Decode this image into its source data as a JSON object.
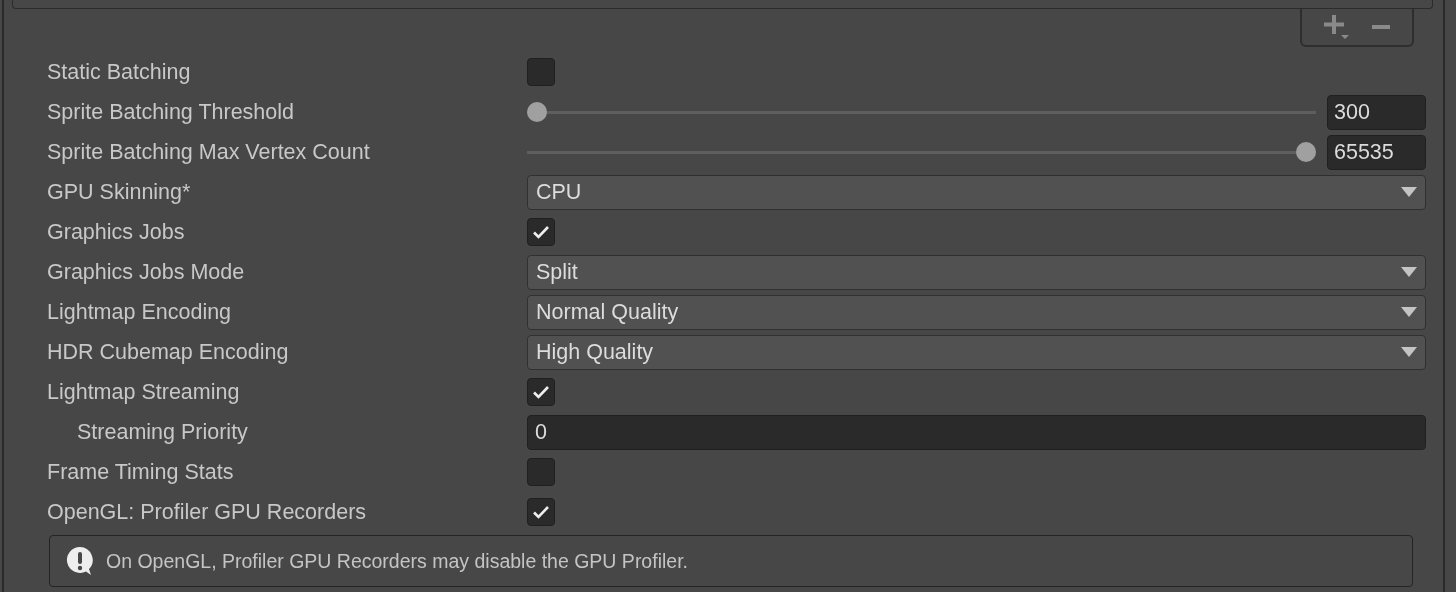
{
  "settings": [
    {
      "label": "Static Batching",
      "kind": "checkbox",
      "checked": false
    },
    {
      "label": "Sprite Batching Threshold",
      "kind": "slider",
      "level": 0.0,
      "value": "300"
    },
    {
      "label": "Sprite Batching Max Vertex Count",
      "kind": "slider",
      "level": 1.0,
      "value": "65535"
    },
    {
      "label": "GPU Skinning*",
      "kind": "dropdown",
      "value": "CPU"
    },
    {
      "label": "Graphics Jobs",
      "kind": "checkbox",
      "checked": true
    },
    {
      "label": "Graphics Jobs Mode",
      "kind": "dropdown",
      "value": "Split"
    },
    {
      "label": "Lightmap Encoding",
      "kind": "dropdown",
      "value": "Normal Quality"
    },
    {
      "label": "HDR Cubemap Encoding",
      "kind": "dropdown",
      "value": "High Quality"
    },
    {
      "label": "Lightmap Streaming",
      "kind": "checkbox",
      "checked": true,
      "children": [
        {
          "label": "Streaming Priority",
          "kind": "text",
          "value": "0"
        }
      ]
    },
    {
      "label": "Frame Timing Stats",
      "kind": "checkbox",
      "checked": false
    },
    {
      "label": "OpenGL: Profiler GPU Recorders",
      "kind": "checkbox",
      "checked": true
    }
  ],
  "help": {
    "message": "On OpenGL, Profiler GPU Recorders may disable the GPU Profiler."
  }
}
